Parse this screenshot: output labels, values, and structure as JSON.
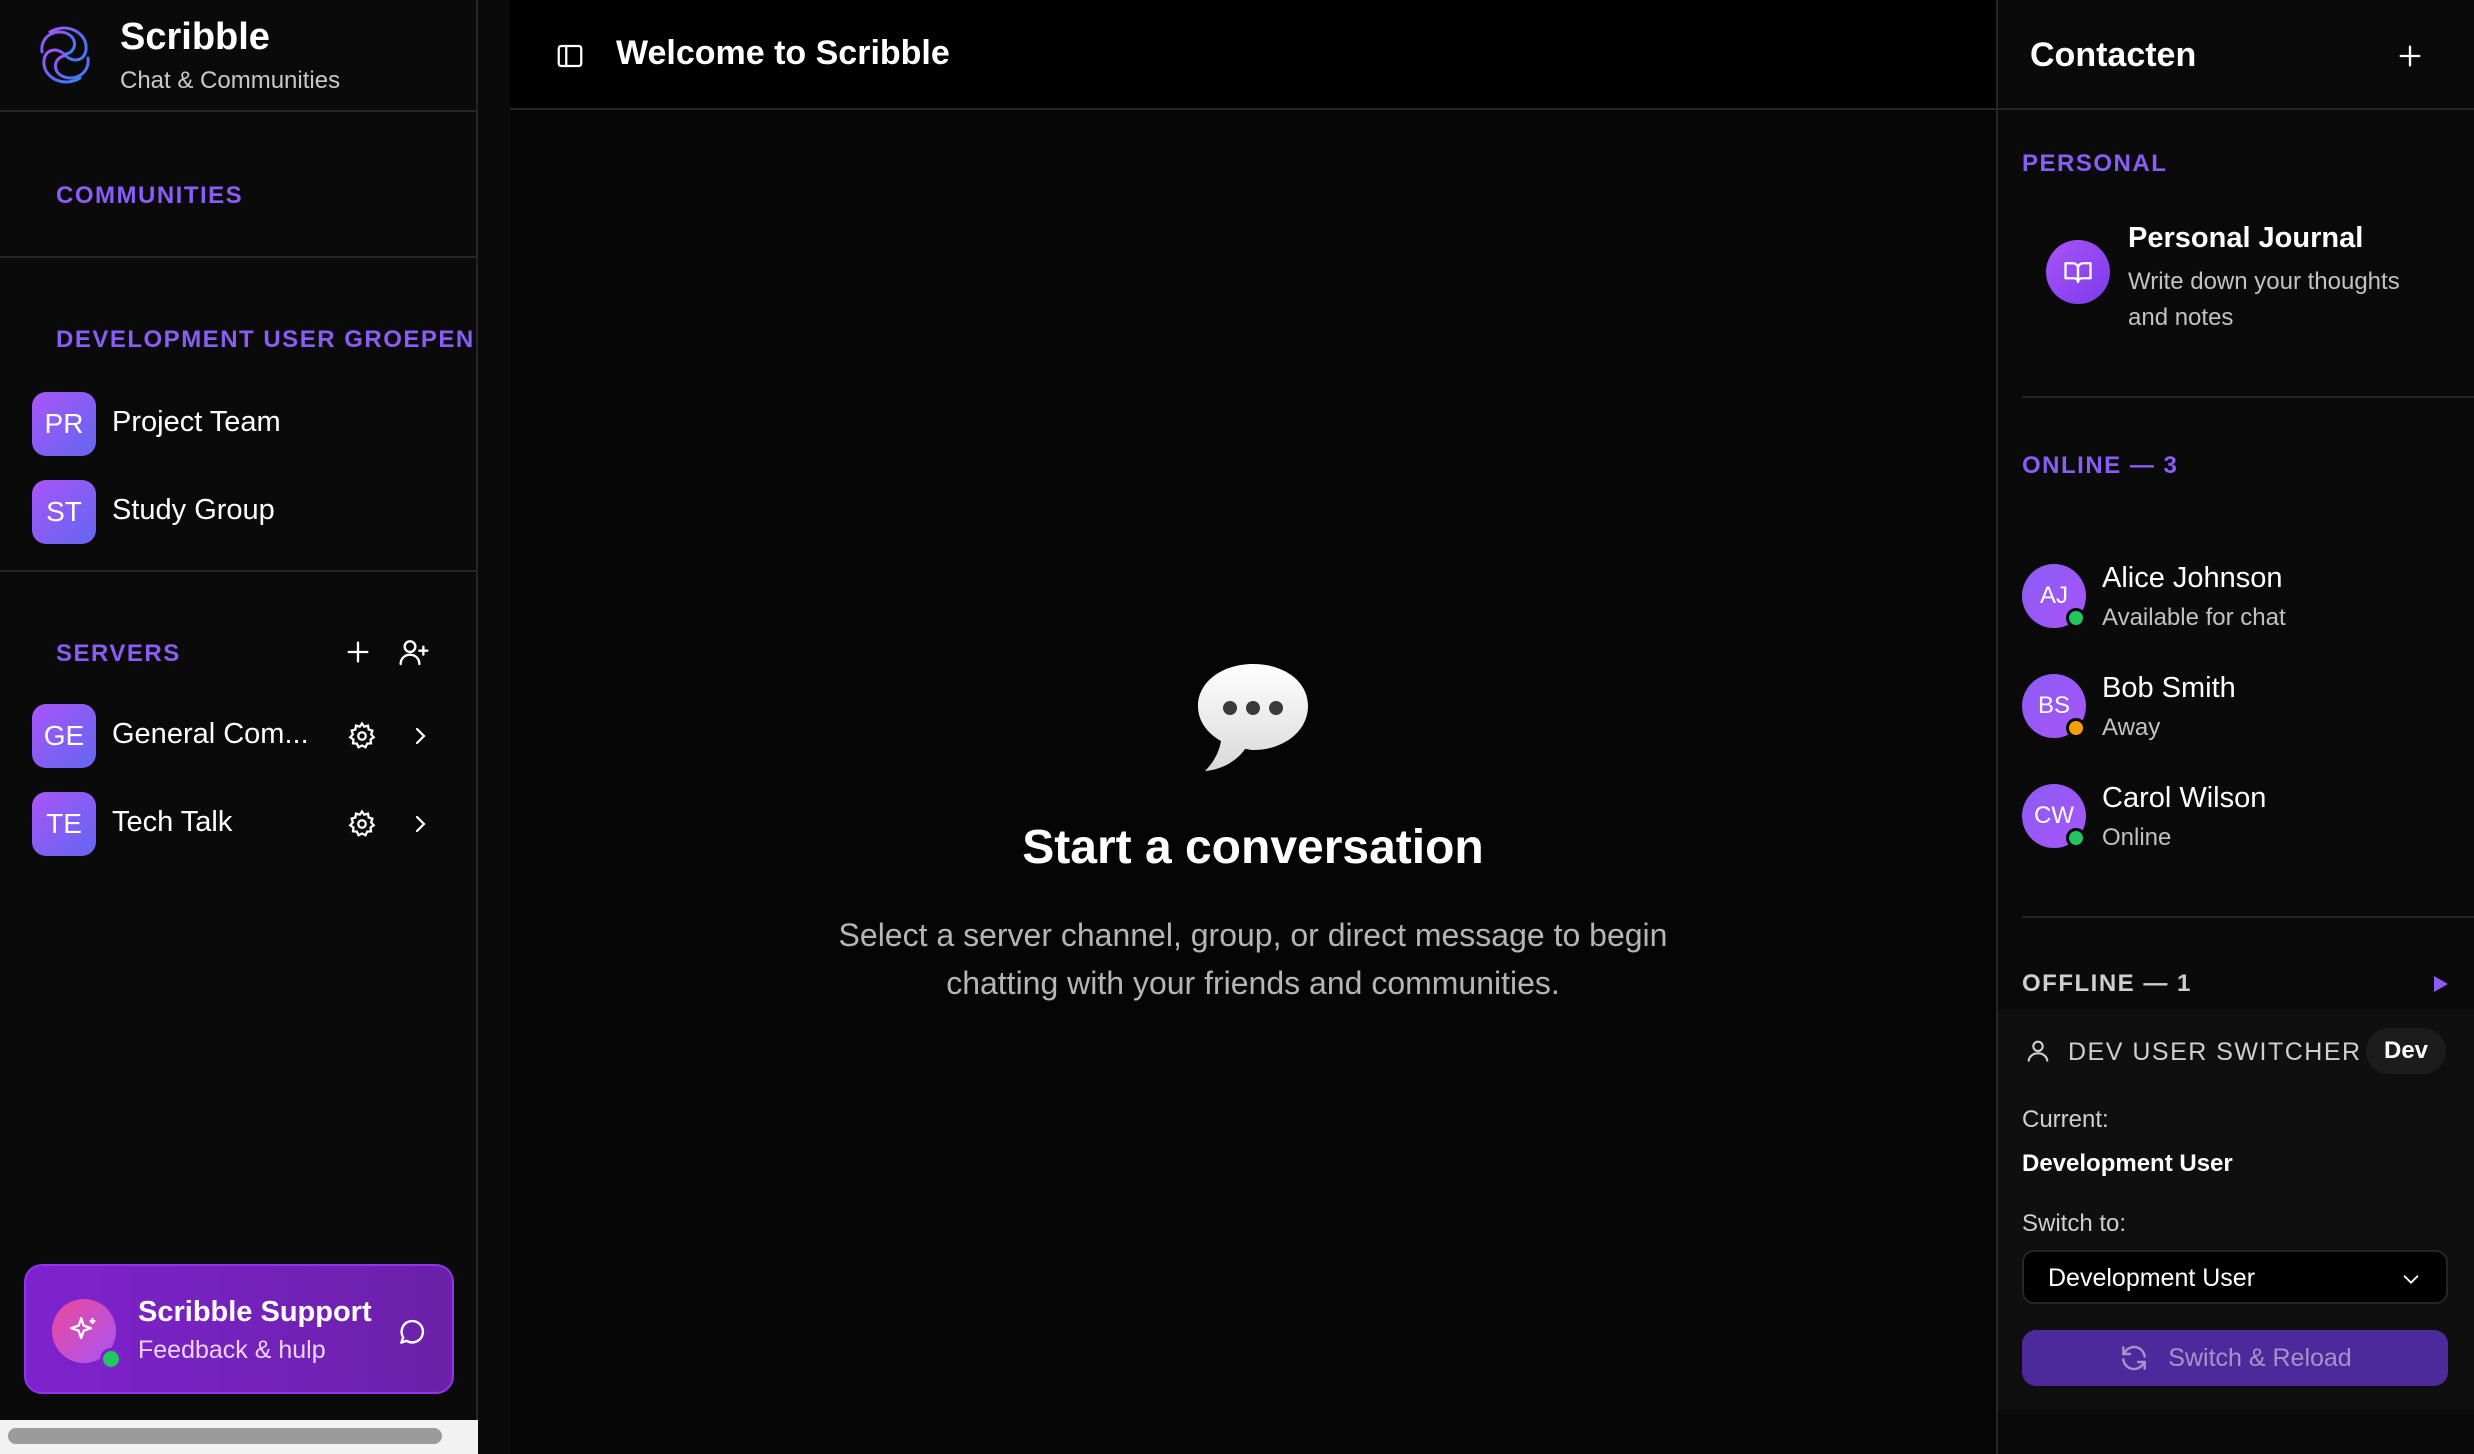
{
  "sidebar": {
    "brand": {
      "title": "Scribble",
      "subtitle": "Chat & Communities"
    },
    "communities_label": "COMMUNITIES",
    "dev_groups_label": "DEVELOPMENT USER GROEPEN",
    "groups": [
      {
        "initials": "PR",
        "label": "Project Team"
      },
      {
        "initials": "ST",
        "label": "Study Group"
      }
    ],
    "servers_label": "SERVERS",
    "servers": [
      {
        "initials": "GE",
        "label": "General Com..."
      },
      {
        "initials": "TE",
        "label": "Tech Talk"
      }
    ],
    "support": {
      "title": "Scribble Support",
      "subtitle": "Feedback & hulp"
    }
  },
  "main": {
    "title": "Welcome to Scribble",
    "empty_title": "Start a conversation",
    "empty_desc": "Select a server channel, group, or direct message to begin chatting with your friends and communities."
  },
  "contacts": {
    "title": "Contacten",
    "personal_label": "PERSONAL",
    "journal": {
      "title": "Personal Journal",
      "desc": "Write down your thoughts and notes"
    },
    "online_label": "ONLINE — 3",
    "online": [
      {
        "initials": "AJ",
        "name": "Alice Johnson",
        "status": "Available for chat",
        "status_color": "#22c55e"
      },
      {
        "initials": "BS",
        "name": "Bob Smith",
        "status": "Away",
        "status_color": "#f59e0b"
      },
      {
        "initials": "CW",
        "name": "Carol Wilson",
        "status": "Online",
        "status_color": "#22c55e"
      }
    ],
    "offline_label": "OFFLINE — 1",
    "dev_switcher": {
      "label": "DEV USER SWITCHER",
      "badge": "Dev",
      "current_label": "Current:",
      "current_value": "Development User",
      "switch_to_label": "Switch to:",
      "selected": "Development User",
      "button": "Switch & Reload"
    }
  },
  "colors": {
    "accent": "#8b5cf6",
    "background": "#0a0a0a",
    "support": "#7e22ce"
  }
}
